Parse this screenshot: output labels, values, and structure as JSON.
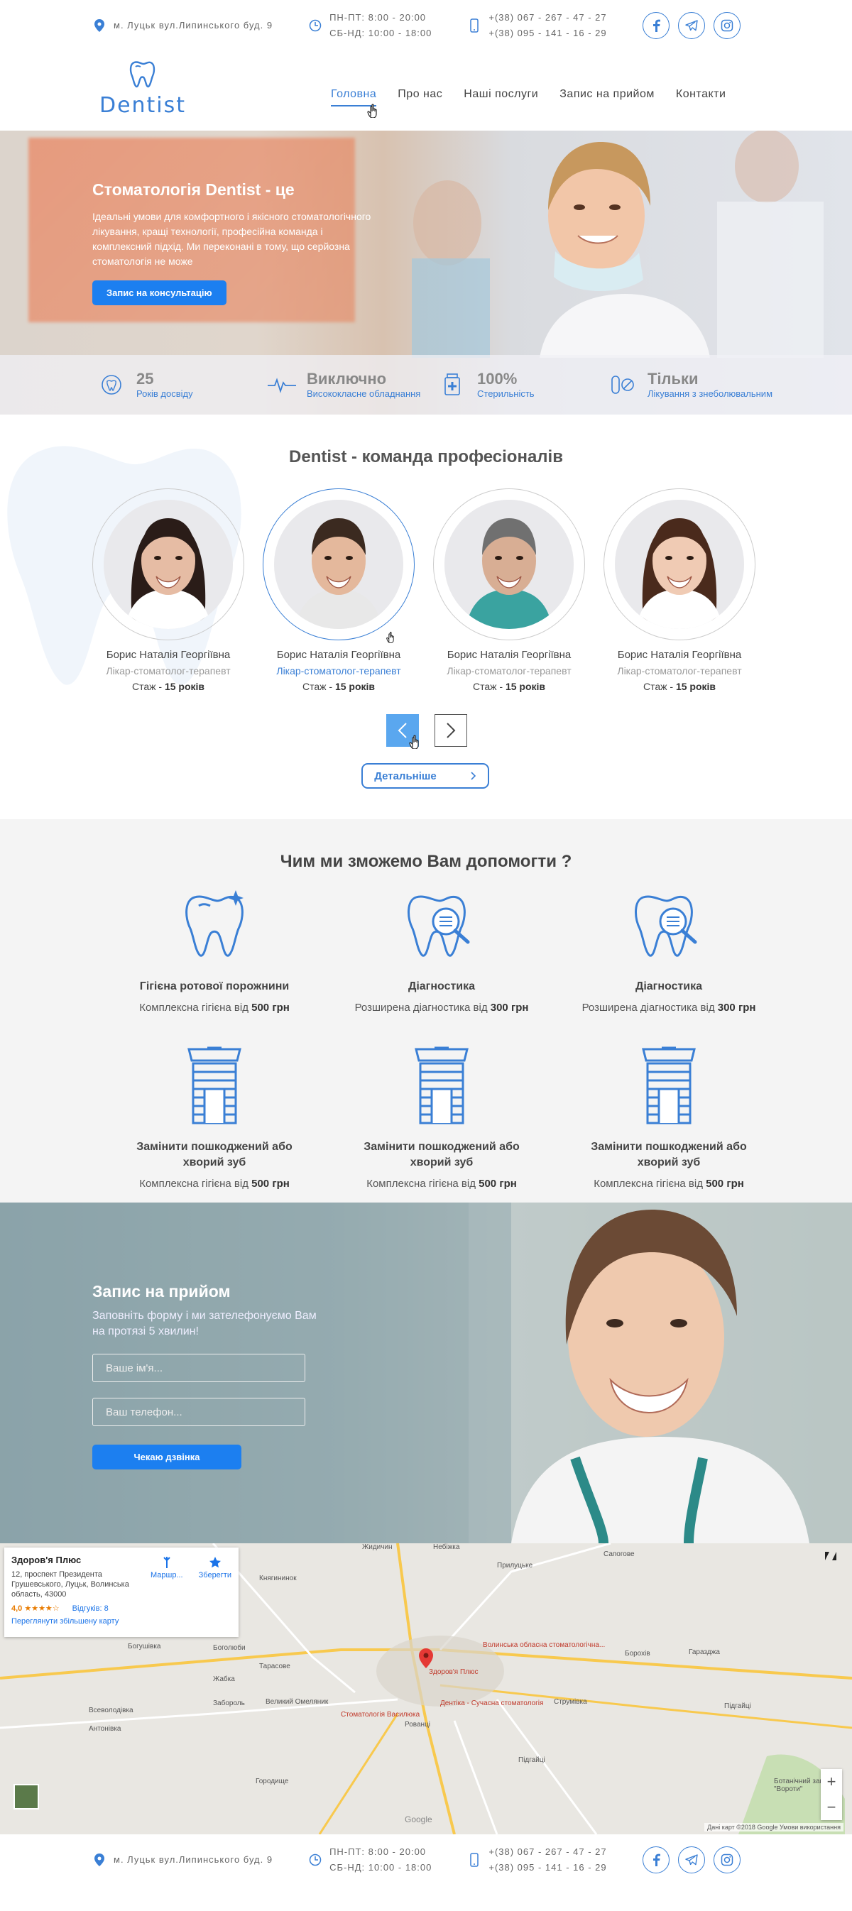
{
  "topbar": {
    "address": "м. Луцьк вул.Липинського  буд. 9",
    "hours_1": "ПН-ПТ:  8:00  -  20:00",
    "hours_2": "СБ-НД:  10:00  -  18:00",
    "phone_1": "+(38)  067 - 267 - 47 - 27",
    "phone_2": "+(38)  095 - 141 - 16 - 29"
  },
  "logo": {
    "name": "Dentist"
  },
  "menu": [
    {
      "label": "Головна",
      "active": true
    },
    {
      "label": "Про нас"
    },
    {
      "label": "Наші послуги"
    },
    {
      "label": "Запис на прийом"
    },
    {
      "label": "Контакти"
    }
  ],
  "hero": {
    "title": "Стоматологія Dentist - це",
    "text": "Ідеальні умови для комфортного і якісного стоматологічного лікування, кращі технології, професійна команда і комплексний підхід. Ми переконані в тому, що серйозна стоматологія не може",
    "button": "Запис на консультацію"
  },
  "stats": [
    {
      "big": "25",
      "small": "Років досвіду",
      "icon": "tooth-circle-icon"
    },
    {
      "big": "Виключно",
      "small": "Висококласне обладнання",
      "icon": "pulse-icon"
    },
    {
      "big": "100%",
      "small": "Стерильність",
      "icon": "medical-jar-icon"
    },
    {
      "big": "Тільки",
      "small": "Лікування з знеболювальним",
      "icon": "pill-icon"
    }
  ],
  "team": {
    "title": "Dentist - команда професіоналів",
    "more": "Детальніше",
    "doctors": [
      {
        "name": "Борис Наталія Георгіївна",
        "role": "Лікар-стоматолог-терапевт",
        "exp_label": "Стаж - ",
        "exp_value": "15 років"
      },
      {
        "name": "Борис Наталія Георгіївна",
        "role": "Лікар-стоматолог-терапевт",
        "exp_label": "Стаж - ",
        "exp_value": "15 років",
        "active": true
      },
      {
        "name": "Борис Наталія Георгіївна",
        "role": "Лікар-стоматолог-терапевт",
        "exp_label": "Стаж - ",
        "exp_value": "15 років"
      },
      {
        "name": "Борис Наталія Георгіївна",
        "role": "Лікар-стоматолог-терапевт",
        "exp_label": "Стаж - ",
        "exp_value": "15 років"
      }
    ]
  },
  "services": {
    "title": "Чим ми зможемо Вам допомогти ?",
    "items": [
      {
        "title": "Гігієна ротової порожнини",
        "desc": "Комплексна гігієна від ",
        "price": "500 грн",
        "icon": "sparkle-tooth-icon"
      },
      {
        "title": "Діагностика",
        "desc": "Розширена діагностика від ",
        "price": "300 грн",
        "icon": "tooth-magnifier-icon"
      },
      {
        "title": "Діагностика",
        "desc": "Розширена діагностика від ",
        "price": "300 грн",
        "icon": "tooth-magnifier-icon"
      },
      {
        "title": "Замінити пошкоджений або хворий зуб",
        "desc": "Комплексна гігієна від ",
        "price": "500 грн",
        "icon": "implant-icon"
      },
      {
        "title": "Замінити пошкоджений або хворий зуб",
        "desc": "Комплексна гігієна від ",
        "price": "500 грн",
        "icon": "implant-icon"
      },
      {
        "title": "Замінити пошкоджений або хворий зуб",
        "desc": "Комплексна гігієна від ",
        "price": "500 грн",
        "icon": "implant-icon"
      }
    ]
  },
  "appointment": {
    "title": "Запис  на прийом",
    "text": "Заповніть форму і ми зателефонуємо Вам на протязі 5 хвилин!",
    "name_placeholder": "Ваше ім'я...",
    "phone_placeholder": "Ваш телефон...",
    "button": "Чекаю дзвінка"
  },
  "map": {
    "place_name": "Здоров'я Плюс",
    "place_address": "12, проспект Президента Грушевського, Луцьк, Волинська область, 43000",
    "rating": "4,0 ★★★★☆",
    "reviews": "Відгуків: 8",
    "enlarge": "Переглянути збільшену карту",
    "route": "Маршр...",
    "save": "Зберегти",
    "google": "Google",
    "footer": "Дані карт ©2018 Google   Умови використання",
    "labels": [
      "Жидичин",
      "Небіжка",
      "Сапогове",
      "Княгининок",
      "Прилуцьке",
      "Гаразджа",
      "Богушівка",
      "Боголюби",
      "Тарасове",
      "Жабка",
      "Забороль",
      "Великий Омеляник",
      "Всеволодівка",
      "Антонівка",
      "Городище",
      "Рованці",
      "Струмівка",
      "Підгайці",
      "Ботанічний заказник \"Вороти\"",
      "Підгайці",
      "Борохів"
    ],
    "red_labels": [
      "Волинська обласна стоматологічна...",
      "Здоров'я Плюс",
      "Дентіка - Сучасна стоматологія",
      "Стоматологія Василюка"
    ],
    "zoom_in": "+",
    "zoom_out": "−"
  },
  "colors": {
    "accent": "#3a7fd5",
    "button": "#1c7ff0"
  }
}
